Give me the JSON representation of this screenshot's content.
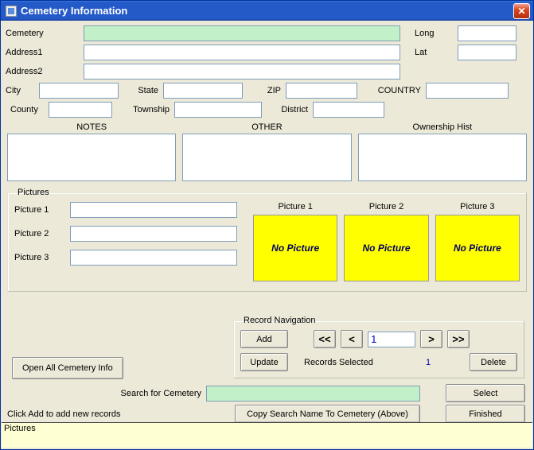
{
  "window": {
    "title": "Cemetery Information"
  },
  "labels": {
    "cemetery": "Cemetery",
    "long": "Long",
    "address1": "Address1",
    "lat": "Lat",
    "address2": "Address2",
    "city": "City",
    "state": "State",
    "zip": "ZIP",
    "country": "COUNTRY",
    "county": "County",
    "township": "Township",
    "district": "District",
    "notes": "NOTES",
    "other": "OTHER",
    "ownership": "Ownership Hist"
  },
  "fields": {
    "cemetery": "",
    "long": "",
    "address1": "",
    "lat": "",
    "address2": "",
    "city": "",
    "state": "",
    "zip": "",
    "country": "",
    "county": "",
    "township": "",
    "district": "",
    "notes": "",
    "other": "",
    "ownership": ""
  },
  "pictures": {
    "legend": "Pictures",
    "label1": "Picture 1",
    "label2": "Picture 2",
    "label3": "Picture 3",
    "path1": "",
    "path2": "",
    "path3": "",
    "no_picture": "No Picture"
  },
  "nav": {
    "legend": "Record Navigation",
    "add": "Add",
    "first": "<<",
    "prev": "<",
    "next": ">",
    "last": ">>",
    "current": "1",
    "update": "Update",
    "records_selected": "Records Selected",
    "count": "1",
    "delete": "Delete"
  },
  "buttons": {
    "open_all": "Open All Cemetery Info",
    "select": "Select",
    "finished": "Finished",
    "copy": "Copy Search Name To Cemetery (Above)"
  },
  "search": {
    "label": "Search for Cemetery",
    "value": ""
  },
  "hint": "Click Add to add new records",
  "footer": "Pictures"
}
